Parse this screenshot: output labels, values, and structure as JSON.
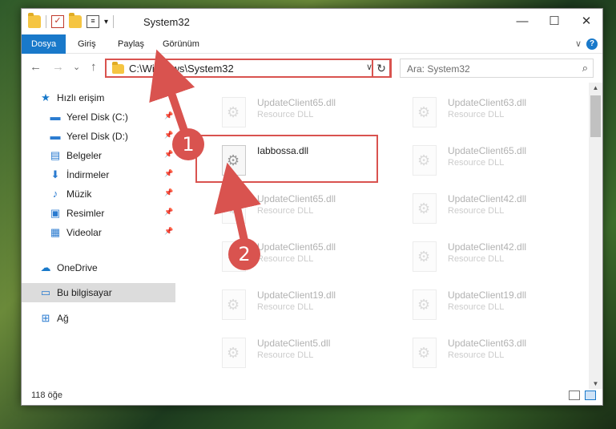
{
  "window": {
    "title": "System32",
    "minimize_glyph": "—",
    "maximize_glyph": "☐",
    "close_glyph": "✕"
  },
  "ribbon": {
    "tabs": [
      "Dosya",
      "Giriş",
      "Paylaş",
      "Görünüm"
    ],
    "help_glyph": "?",
    "collapse_glyph": "∨"
  },
  "navigation": {
    "back_glyph": "←",
    "forward_glyph": "→",
    "recent_glyph": "⌄",
    "up_glyph": "↑",
    "address_path": "C:\\Windows\\System32",
    "dropdown_glyph": "∨",
    "refresh_glyph": "↻",
    "search_placeholder": "Ara: System32",
    "search_glyph": "⌕"
  },
  "sidebar": {
    "quick_access": "Hızlı erişim",
    "items": [
      {
        "label": "Yerel Disk (C:)",
        "icon": "drive-icon",
        "pinned": true
      },
      {
        "label": "Yerel Disk (D:)",
        "icon": "drive-icon",
        "pinned": true
      },
      {
        "label": "Belgeler",
        "icon": "documents-icon",
        "pinned": true
      },
      {
        "label": "İndirmeler",
        "icon": "downloads-icon",
        "pinned": true
      },
      {
        "label": "Müzik",
        "icon": "music-icon",
        "pinned": true
      },
      {
        "label": "Resimler",
        "icon": "pictures-icon",
        "pinned": true
      },
      {
        "label": "Videolar",
        "icon": "videos-icon",
        "pinned": true
      }
    ],
    "onedrive": "OneDrive",
    "this_pc": "Bu bilgisayar",
    "network": "Ağ"
  },
  "files": {
    "left_column": [
      {
        "name": "UpdateClient65.dll",
        "type": "Resource DLL",
        "faded": true
      },
      {
        "name": "Iabbossa.dll",
        "type": "",
        "faded": false
      },
      {
        "name": "UpdateClient65.dll",
        "type": "Resource DLL",
        "faded": true
      },
      {
        "name": "UpdateClient65.dll",
        "type": "Resource DLL",
        "faded": true
      },
      {
        "name": "UpdateClient19.dll",
        "type": "Resource DLL",
        "faded": true
      },
      {
        "name": "UpdateClient5.dll",
        "type": "Resource DLL",
        "faded": true
      }
    ],
    "right_column": [
      {
        "name": "UpdateClient63.dll",
        "type": "Resource DLL",
        "faded": true
      },
      {
        "name": "UpdateClient65.dll",
        "type": "Resource DLL",
        "faded": true
      },
      {
        "name": "UpdateClient42.dll",
        "type": "Resource DLL",
        "faded": true
      },
      {
        "name": "UpdateClient42.dll",
        "type": "Resource DLL",
        "faded": true
      },
      {
        "name": "UpdateClient19.dll",
        "type": "Resource DLL",
        "faded": true
      },
      {
        "name": "UpdateClient63.dll",
        "type": "Resource DLL",
        "faded": true
      }
    ]
  },
  "status": {
    "item_count": "118 öğe"
  },
  "annotations": {
    "callout_1": "1",
    "callout_2": "2",
    "color": "#d9534f"
  },
  "colors": {
    "accent": "#1979ca",
    "highlight": "#d9534f"
  }
}
